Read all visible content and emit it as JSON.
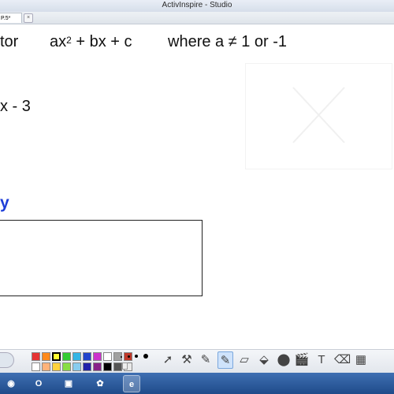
{
  "window": {
    "title": "ActivInspire - Studio"
  },
  "tabs": [
    {
      "label": "P.5*",
      "close": "×"
    }
  ],
  "flipchart": {
    "line1_left": "tor",
    "line1_expr_a": "ax",
    "line1_exp": "2",
    "line1_expr_b": "+ bx + c",
    "line1_condition": "where a ≠ 1 or -1",
    "line2": "x - 3",
    "line3": "y"
  },
  "palette": {
    "row1": [
      "#e53333",
      "#ff8a1c",
      "#ffff33",
      "#33cc33",
      "#33b5e5",
      "#2244cc",
      "#cc33cc",
      "#ffffff",
      "#a0a0a0",
      "#c0392b"
    ],
    "row2": [
      "#ffffff",
      "#ffb37a",
      "#ffd23c",
      "#88dd44",
      "#88ccee",
      "#2222aa",
      "#882288",
      "#000000",
      "#555555",
      "#e9e9e9"
    ]
  },
  "tools": [
    {
      "name": "select-tool",
      "glyph": "➚"
    },
    {
      "name": "tools-icon",
      "glyph": "⚒"
    },
    {
      "name": "pen-tool",
      "glyph": "✎"
    },
    {
      "name": "highlighter-tool",
      "glyph": "✎"
    },
    {
      "name": "eraser-tool",
      "glyph": "▱"
    },
    {
      "name": "fill-tool",
      "glyph": "⬙"
    },
    {
      "name": "shape-tool",
      "glyph": "⬤"
    },
    {
      "name": "clapper-tool",
      "glyph": "🎬"
    },
    {
      "name": "text-tool",
      "glyph": "T"
    },
    {
      "name": "delete-tool",
      "glyph": "⌫"
    },
    {
      "name": "more-tool",
      "glyph": "▦"
    }
  ],
  "taskbar": [
    {
      "name": "firefox-icon",
      "glyph": "◉"
    },
    {
      "name": "outlook-icon",
      "glyph": "O"
    },
    {
      "name": "app-icon",
      "glyph": "▣"
    },
    {
      "name": "activinspire-icon",
      "glyph": "✿"
    },
    {
      "name": "ie-icon",
      "glyph": "e"
    }
  ]
}
